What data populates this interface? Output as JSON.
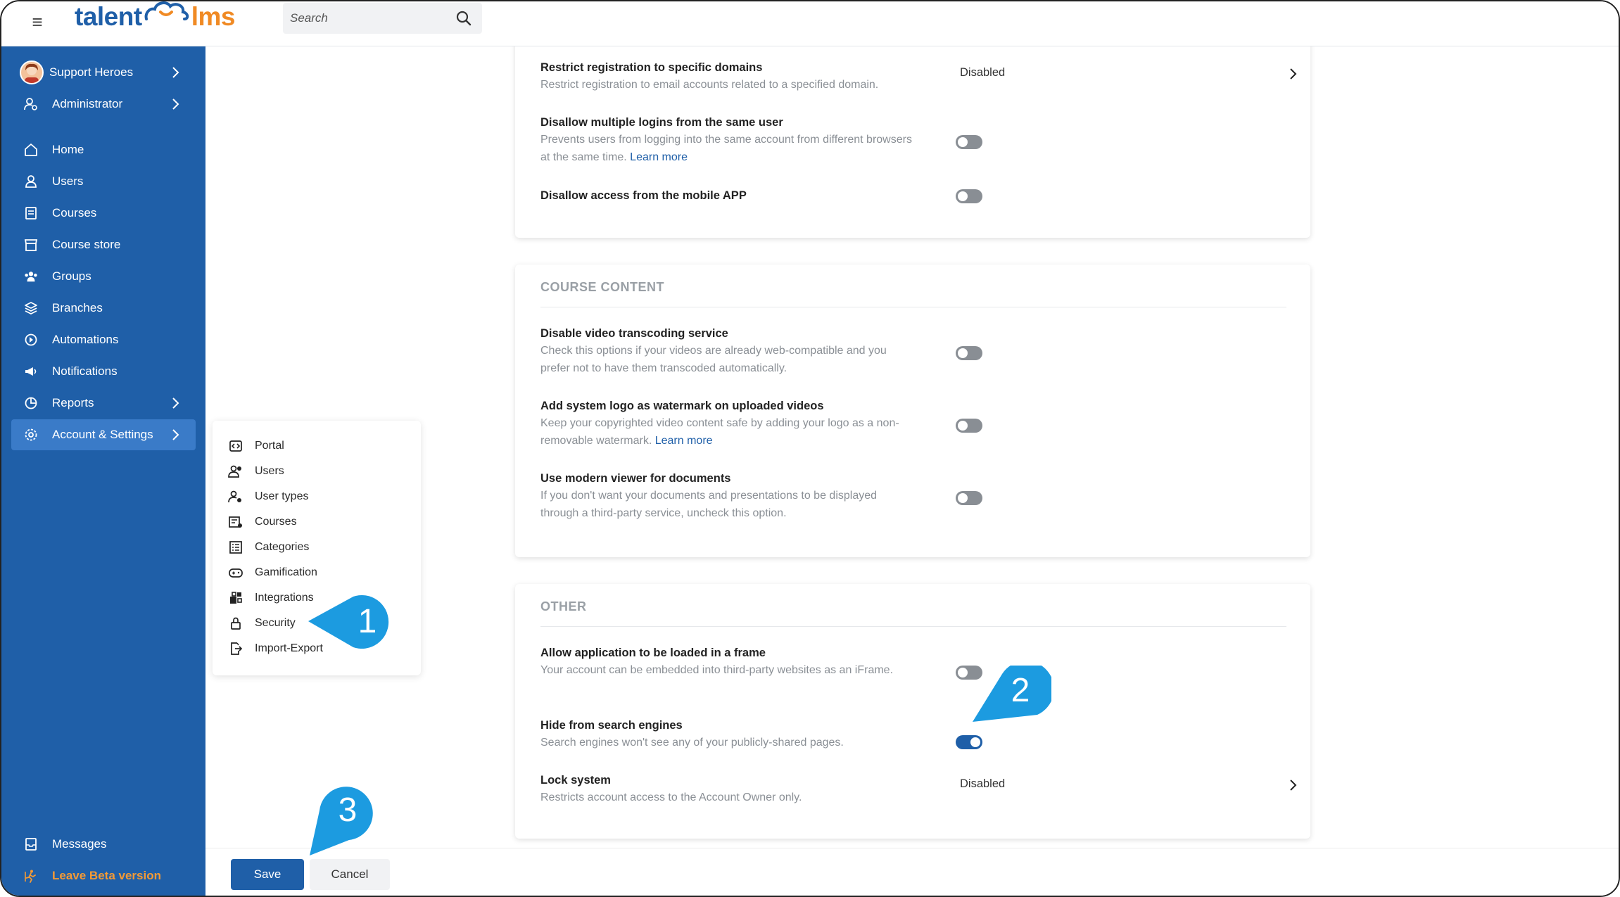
{
  "brand": {
    "logo_part1": "talent",
    "logo_part2": "lms",
    "primary_color": "#1f5fa8",
    "accent_color": "#f08a24"
  },
  "search": {
    "placeholder": "Search"
  },
  "sidebar": {
    "account": {
      "label": "Support Heroes"
    },
    "role": {
      "label": "Administrator"
    },
    "items": [
      {
        "label": "Home",
        "icon": "home-icon"
      },
      {
        "label": "Users",
        "icon": "user-icon"
      },
      {
        "label": "Courses",
        "icon": "book-icon"
      },
      {
        "label": "Course store",
        "icon": "store-icon"
      },
      {
        "label": "Groups",
        "icon": "groups-icon"
      },
      {
        "label": "Branches",
        "icon": "layers-icon"
      },
      {
        "label": "Automations",
        "icon": "automation-icon"
      },
      {
        "label": "Notifications",
        "icon": "megaphone-icon"
      },
      {
        "label": "Reports",
        "icon": "pie-chart-icon"
      },
      {
        "label": "Account & Settings",
        "icon": "gear-icon"
      }
    ],
    "messages": "Messages",
    "leave_beta": "Leave Beta version"
  },
  "submenu": {
    "items": [
      {
        "label": "Portal",
        "icon": "portal-icon"
      },
      {
        "label": "Users",
        "icon": "users-icon"
      },
      {
        "label": "User types",
        "icon": "user-types-icon"
      },
      {
        "label": "Courses",
        "icon": "courses-icon"
      },
      {
        "label": "Categories",
        "icon": "categories-icon"
      },
      {
        "label": "Gamification",
        "icon": "gamepad-icon"
      },
      {
        "label": "Integrations",
        "icon": "integrations-icon"
      },
      {
        "label": "Security",
        "icon": "lock-icon"
      },
      {
        "label": "Import-Export",
        "icon": "import-export-icon"
      }
    ]
  },
  "section_top": {
    "rows": [
      {
        "title": "Restrict registration to specific domains",
        "desc": "Restrict registration to email accounts related to a specified domain.",
        "value": "Disabled"
      },
      {
        "title": "Disallow multiple logins from the same user",
        "desc": "Prevents users from logging into the same account from different browsers at the same time.",
        "link": "Learn more",
        "toggle": false
      },
      {
        "title": "Disallow access from the mobile APP",
        "toggle": false
      }
    ]
  },
  "course_content": {
    "title": "COURSE CONTENT",
    "rows": [
      {
        "title": "Disable video transcoding service",
        "desc": "Check this options if your videos are already web-compatible and you prefer not to have them transcoded automatically.",
        "toggle": false
      },
      {
        "title": "Add system logo as watermark on uploaded videos",
        "desc": "Keep your copyrighted video content safe by adding your logo as a non-removable watermark.",
        "link": "Learn more",
        "toggle": false
      },
      {
        "title": "Use modern viewer for documents",
        "desc": "If you don't want your documents and presentations to be displayed through a third-party service, uncheck this option.",
        "toggle": false
      }
    ]
  },
  "other": {
    "title": "OTHER",
    "rows": [
      {
        "title": "Allow application to be loaded in a frame",
        "desc": "Your account can be embedded into third-party websites as an iFrame.",
        "toggle": false
      },
      {
        "title": "Hide from search engines",
        "desc": "Search engines won't see any of your publicly-shared pages.",
        "toggle": true
      },
      {
        "title": "Lock system",
        "desc": "Restricts account access to the Account Owner only.",
        "value": "Disabled"
      }
    ]
  },
  "actions": {
    "save": "Save",
    "cancel": "Cancel"
  },
  "callouts": {
    "one": "1",
    "two": "2",
    "three": "3",
    "color": "#1c9be0"
  }
}
